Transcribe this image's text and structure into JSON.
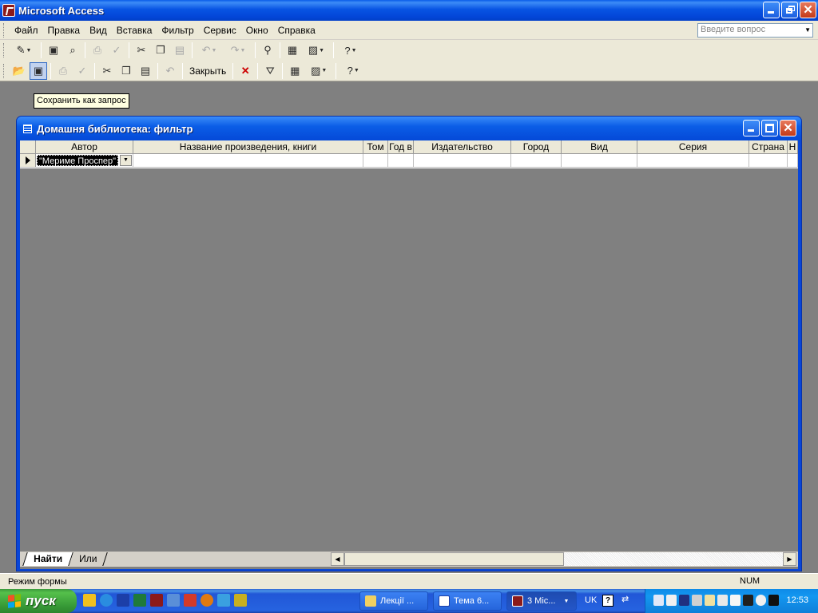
{
  "app": {
    "title": "Microsoft Access"
  },
  "menu": {
    "items": [
      "Файл",
      "Правка",
      "Вид",
      "Вставка",
      "Фильтр",
      "Сервис",
      "Окно",
      "Справка"
    ],
    "ask_placeholder": "Введите вопрос"
  },
  "toolbar2": {
    "close_label": "Закрыть"
  },
  "tooltip": "Сохранить как запрос",
  "filter_window": {
    "title": "Домашня библиотека: фильтр",
    "columns": [
      "Автор",
      "Название произведения, книги",
      "Том",
      "Год в",
      "Издательство",
      "Город",
      "Вид",
      "Серия",
      "Страна",
      "Н"
    ],
    "author_value": "\"Мериме Проспер\"",
    "tabs": [
      "Найти",
      "Или"
    ]
  },
  "status": {
    "mode": "Режим формы",
    "num": "NUM"
  },
  "taskbar": {
    "start": "пуск",
    "tasks": [
      "Лекції ...",
      "Тема 6...",
      "3 Mic..."
    ],
    "lang": "UK",
    "clock": "12:53"
  },
  "colors": {
    "titlebar": "#0854e3",
    "desktop": "#808080",
    "tooltip_bg": "#ffffe1",
    "start_green": "#379a37"
  }
}
